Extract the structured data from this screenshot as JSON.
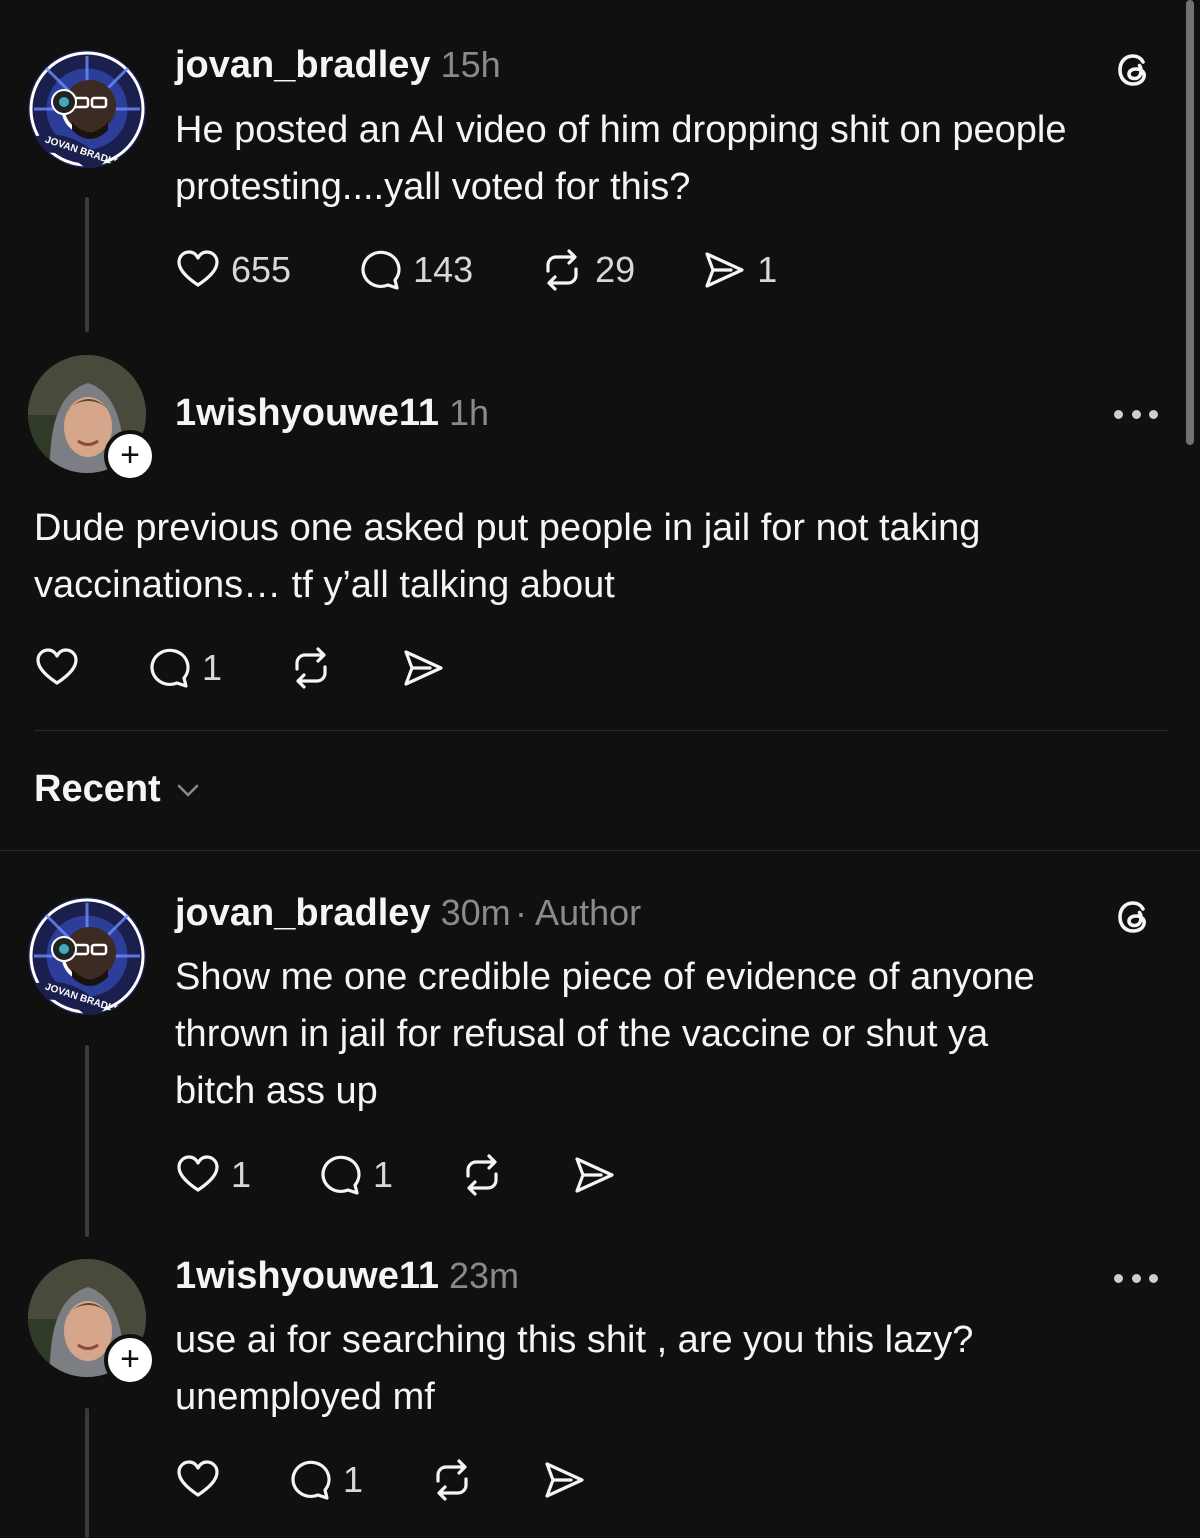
{
  "posts": [
    {
      "username": "jovan_bradley",
      "time": "15h",
      "author_tag": "",
      "avatar_text": "JOVAN BRADLEY",
      "text_lines": [
        "He posted an AI video of him dropping shit on people",
        "protesting....yall voted for this?"
      ],
      "likes": "655",
      "comments": "143",
      "reposts": "29",
      "shares": "1"
    },
    {
      "username": "1wishyouwe11",
      "time": "1h",
      "text_lines": [
        "Dude previous one asked put people in jail for not taking",
        "vaccinations… tf y’all talking about"
      ],
      "likes": "",
      "comments": "1",
      "reposts": "",
      "shares": ""
    },
    {
      "username": "jovan_bradley",
      "time": "30m",
      "author_tag": "· Author",
      "avatar_text": "JOVAN BRADLEY",
      "text_lines": [
        "Show me one credible piece of evidence of anyone",
        "thrown in jail for refusal of the vaccine or shut ya",
        "bitch ass up"
      ],
      "likes": "1",
      "comments": "1",
      "reposts": "",
      "shares": ""
    },
    {
      "username": "1wishyouwe11",
      "time": "23m",
      "text_lines": [
        "use ai for searching this shit , are you this lazy?",
        "unemployed mf"
      ],
      "likes": "",
      "comments": "1",
      "reposts": "",
      "shares": ""
    }
  ],
  "sort": {
    "label": "Recent"
  },
  "icons": [
    "threads-logo-icon",
    "heart-icon",
    "comment-icon",
    "repost-icon",
    "share-icon",
    "more-icon",
    "chevron-down-icon",
    "follow-plus-icon"
  ]
}
